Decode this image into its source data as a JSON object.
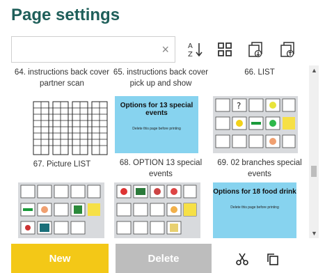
{
  "title": "Page settings",
  "search": {
    "value": "",
    "placeholder": "",
    "clear_icon": "×"
  },
  "toolbar": {
    "sort_icon": "sort-az-icon",
    "grid_icon": "grid-icon",
    "import_icon": "import-page-icon",
    "export_icon": "export-page-icon"
  },
  "pages": [
    {
      "label": "64. instructions back cover partner scan",
      "thumb": "none"
    },
    {
      "label": "65. instructions back cover pick up and show",
      "thumb": "none"
    },
    {
      "label": "66. LIST",
      "thumb": "none"
    },
    {
      "label": "67. Picture LIST",
      "thumb": "table"
    },
    {
      "label": "68. OPTION 13 special events",
      "thumb": "blue",
      "thumb_title": "Options for 13 special events",
      "thumb_note": "Delete this page before printing"
    },
    {
      "label": "69. 02 branches special events",
      "thumb": "grey"
    },
    {
      "label": "",
      "thumb": "grey"
    },
    {
      "label": "",
      "thumb": "grey"
    },
    {
      "label": "",
      "thumb": "blue",
      "thumb_title": "Options for 18 food drink",
      "thumb_note": "Delete this page before printing"
    }
  ],
  "buttons": {
    "new": "New",
    "delete": "Delete"
  },
  "bottom_icons": {
    "cut": "scissors-icon",
    "copy": "copy-icon"
  },
  "colors": {
    "title": "#1f5f5a",
    "new": "#f3c817",
    "delete": "#bdbdbd",
    "blue_thumb": "#87d3ef"
  }
}
